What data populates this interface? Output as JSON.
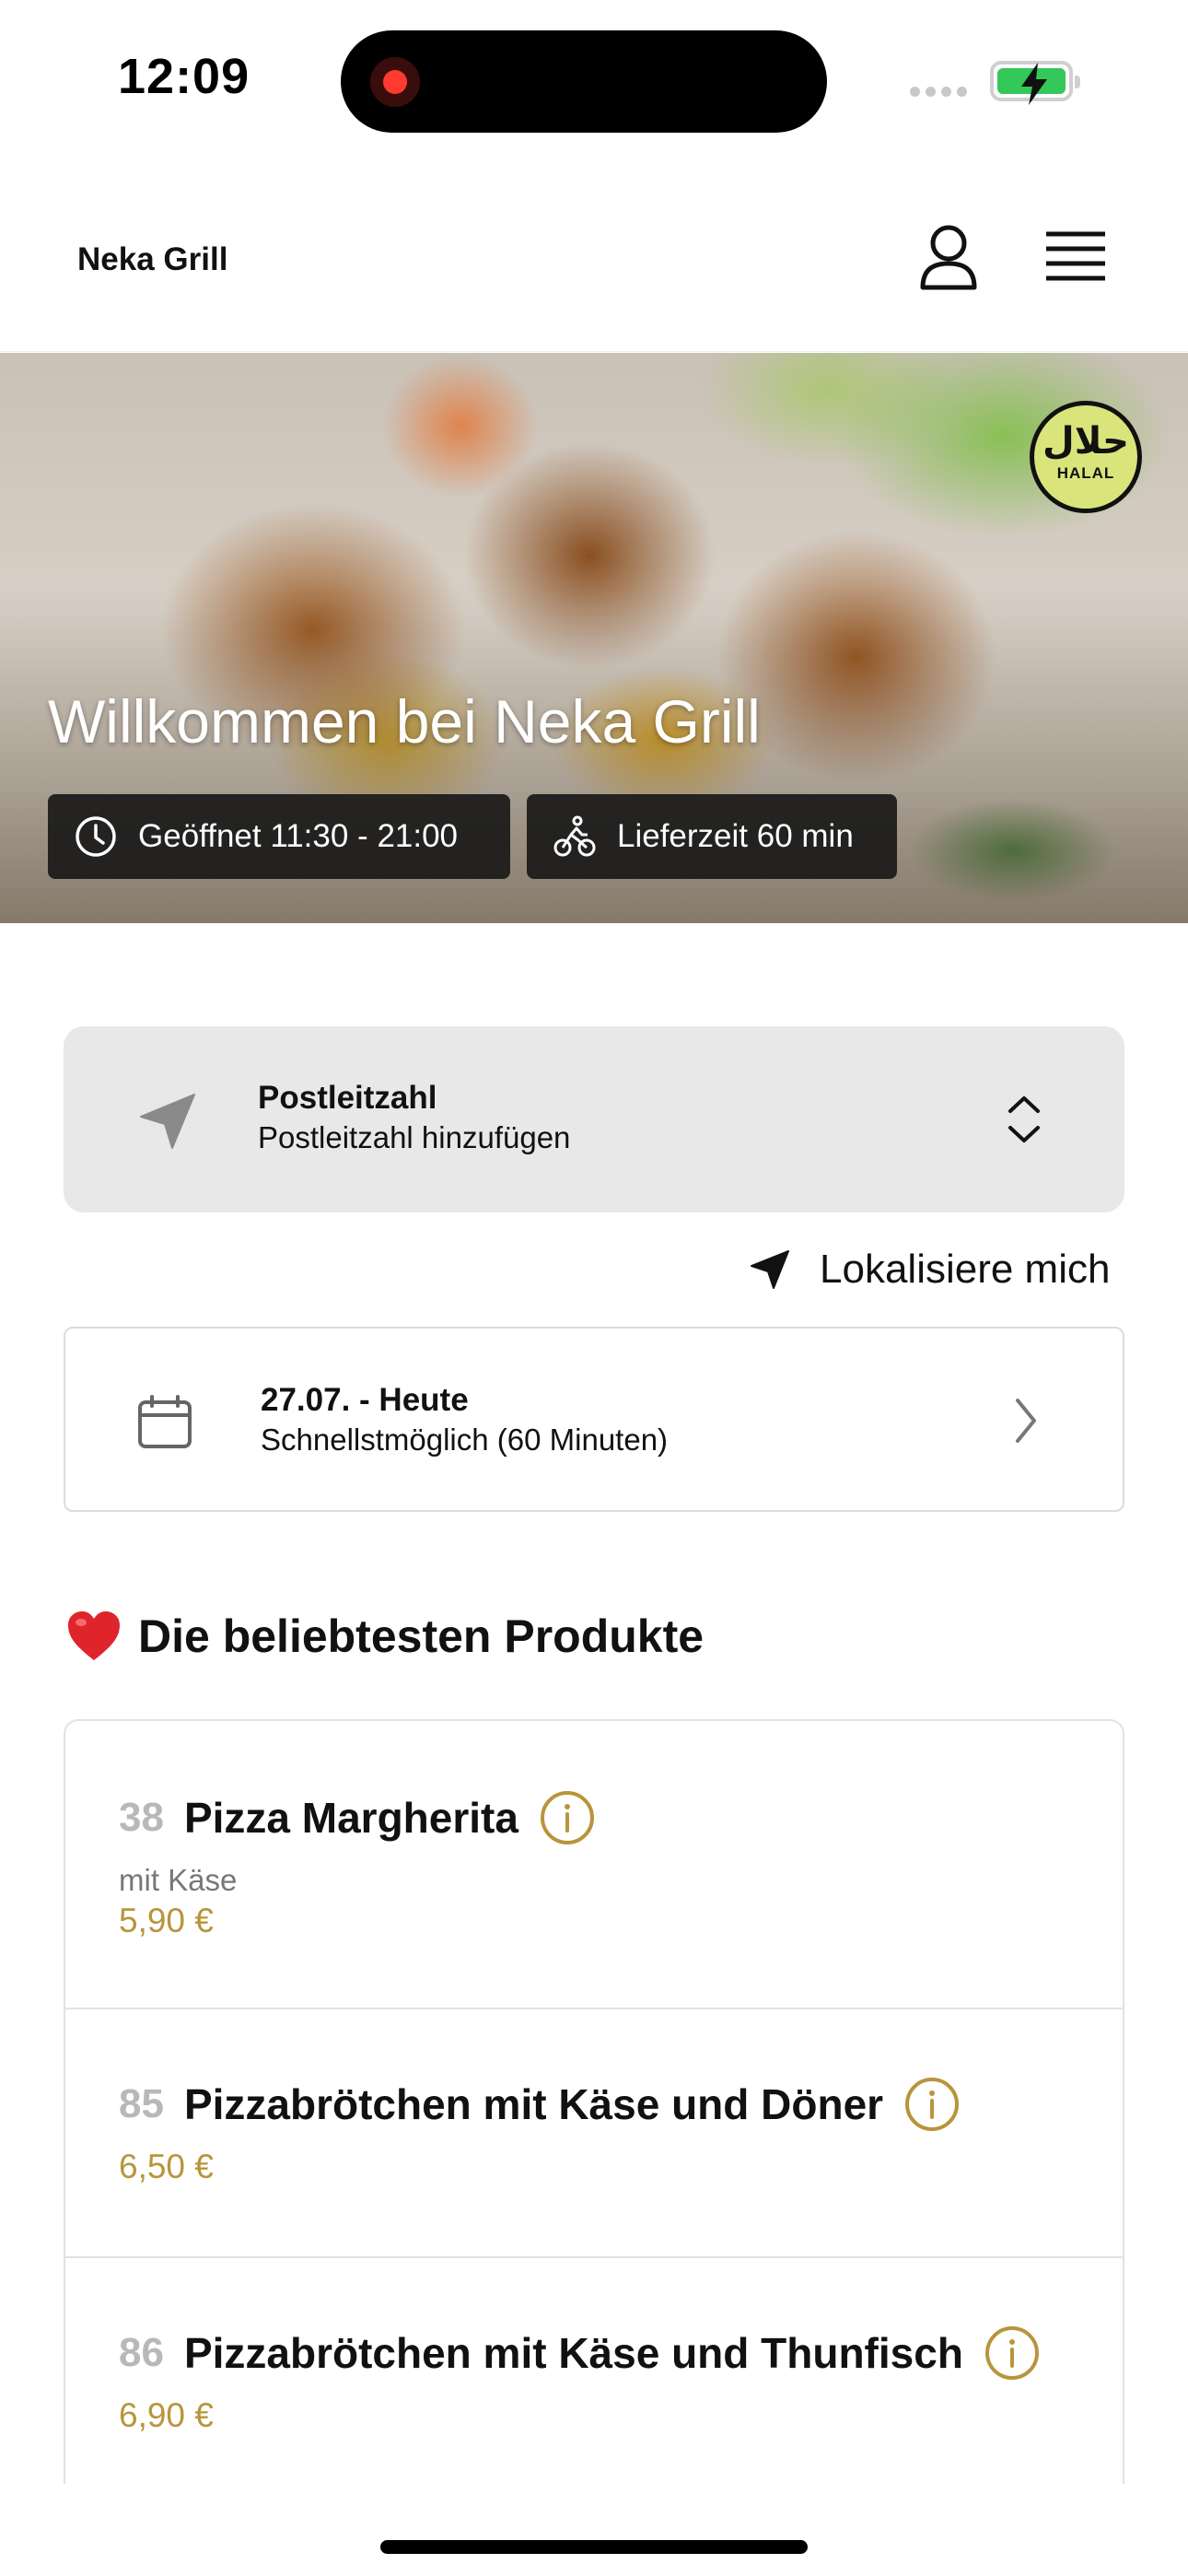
{
  "status_bar": {
    "time": "12:09",
    "recording_indicator": "record-icon",
    "battery_state": "charging",
    "battery_color": "#34c759"
  },
  "header": {
    "brand": "Neka Grill",
    "account_icon": "user-icon",
    "menu_icon": "hamburger-menu-icon"
  },
  "hero": {
    "title": "Willkommen bei Neka Grill",
    "badge_arabic": "حلال",
    "badge_text": "HALAL",
    "opening_hours": "Geöffnet 11:30 - 21:00",
    "delivery_time": "Lieferzeit 60 min"
  },
  "postcode": {
    "label": "Postleitzahl",
    "placeholder": "Postleitzahl hinzufügen"
  },
  "locate": {
    "label": "Lokalisiere mich"
  },
  "schedule": {
    "date": "27.07. - Heute",
    "option": "Schnellstmöglich (60 Minuten)"
  },
  "popular": {
    "emoji": "heart-icon",
    "title": "Die beliebtesten Produkte",
    "items": [
      {
        "number": "38",
        "name": "Pizza Margherita",
        "description": "mit Käse",
        "price": "5,90 €"
      },
      {
        "number": "85",
        "name": "Pizzabrötchen mit Käse und Döner",
        "description": "",
        "price": "6,50 €"
      },
      {
        "number": "86",
        "name": "Pizzabrötchen mit Käse und Thunfisch",
        "description": "",
        "price": "6,90 €"
      }
    ]
  },
  "colors": {
    "accent_gold": "#b8953c",
    "pill_background": "#191919",
    "postcode_background": "#e8e8e8"
  }
}
